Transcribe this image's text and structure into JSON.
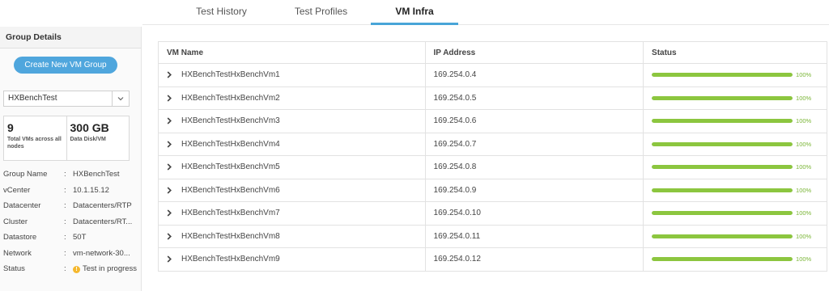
{
  "tabs": [
    {
      "label": "Test History",
      "active": false
    },
    {
      "label": "Test Profiles",
      "active": false
    },
    {
      "label": "VM Infra",
      "active": true
    }
  ],
  "sidebar": {
    "title": "Group Details",
    "create_button": "Create New VM Group",
    "group_select": {
      "value": "HXBenchTest"
    },
    "stats": [
      {
        "value": "9",
        "label": "Total VMs across all nodes"
      },
      {
        "value": "300 GB",
        "label": "Data Disk/VM"
      }
    ],
    "details": [
      {
        "key": "Group Name",
        "value": "HXBenchTest"
      },
      {
        "key": "vCenter",
        "value": "10.1.15.12"
      },
      {
        "key": "Datacenter",
        "value": "Datacenters/RTP"
      },
      {
        "key": "Cluster",
        "value": "Datacenters/RT..."
      },
      {
        "key": "Datastore",
        "value": "50T"
      },
      {
        "key": "Network",
        "value": "vm-network-30..."
      },
      {
        "key": "Status",
        "value": "Test in progress",
        "icon": "warning-icon"
      }
    ],
    "separator": ":"
  },
  "table": {
    "columns": [
      "VM Name",
      "IP Address",
      "Status"
    ],
    "rows": [
      {
        "name": "HXBenchTestHxBenchVm1",
        "ip": "169.254.0.4",
        "progress": 100,
        "progress_label": "100%"
      },
      {
        "name": "HXBenchTestHxBenchVm2",
        "ip": "169.254.0.5",
        "progress": 100,
        "progress_label": "100%"
      },
      {
        "name": "HXBenchTestHxBenchVm3",
        "ip": "169.254.0.6",
        "progress": 100,
        "progress_label": "100%"
      },
      {
        "name": "HXBenchTestHxBenchVm4",
        "ip": "169.254.0.7",
        "progress": 100,
        "progress_label": "100%"
      },
      {
        "name": "HXBenchTestHxBenchVm5",
        "ip": "169.254.0.8",
        "progress": 100,
        "progress_label": "100%"
      },
      {
        "name": "HXBenchTestHxBenchVm6",
        "ip": "169.254.0.9",
        "progress": 100,
        "progress_label": "100%"
      },
      {
        "name": "HXBenchTestHxBenchVm7",
        "ip": "169.254.0.10",
        "progress": 100,
        "progress_label": "100%"
      },
      {
        "name": "HXBenchTestHxBenchVm8",
        "ip": "169.254.0.11",
        "progress": 100,
        "progress_label": "100%"
      },
      {
        "name": "HXBenchTestHxBenchVm9",
        "ip": "169.254.0.12",
        "progress": 100,
        "progress_label": "100%"
      }
    ]
  },
  "colors": {
    "accent": "#49a5d8",
    "button": "#4fa6dd",
    "progress": "#8cc63f",
    "warning": "#f5b82e"
  }
}
